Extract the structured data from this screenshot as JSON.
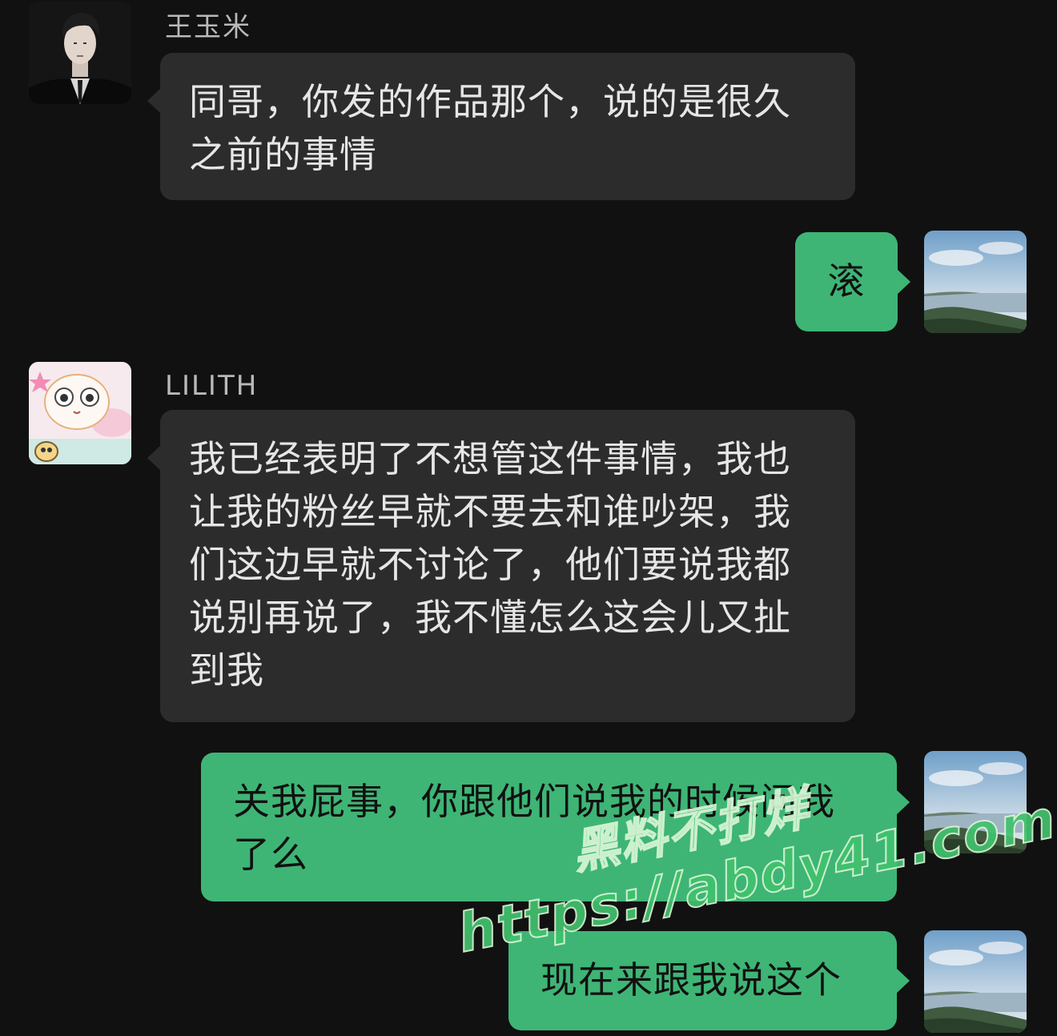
{
  "messages": [
    {
      "sender": "王玉米",
      "avatar_icon": "man-in-suit-avatar",
      "text": "同哥，你发的作品那个，说的是很久之前的事情"
    },
    {
      "sender": "self",
      "avatar_icon": "lake-landscape-avatar",
      "text": "滚"
    },
    {
      "sender": "LILITH",
      "avatar_icon": "cartoon-cat-avatar",
      "text": "我已经表明了不想管这件事情，我也让我的粉丝早就不要去和谁吵架，我们这边早就不讨论了，他们要说我都说别再说了，我不懂怎么这会儿又扯到我"
    },
    {
      "sender": "self",
      "avatar_icon": "lake-landscape-avatar",
      "text": "关我屁事，你跟他们说我的时候问我了么"
    },
    {
      "sender": "self",
      "avatar_icon": "lake-landscape-avatar",
      "text": "现在来跟我说这个"
    }
  ],
  "watermark": {
    "line1": "黑料不打烊",
    "line2": "https://abdy41.com"
  },
  "colors": {
    "background": "#111111",
    "incoming_bubble": "#2c2c2c",
    "outgoing_bubble": "#3eb575",
    "sender_name": "#b9b9b9"
  }
}
